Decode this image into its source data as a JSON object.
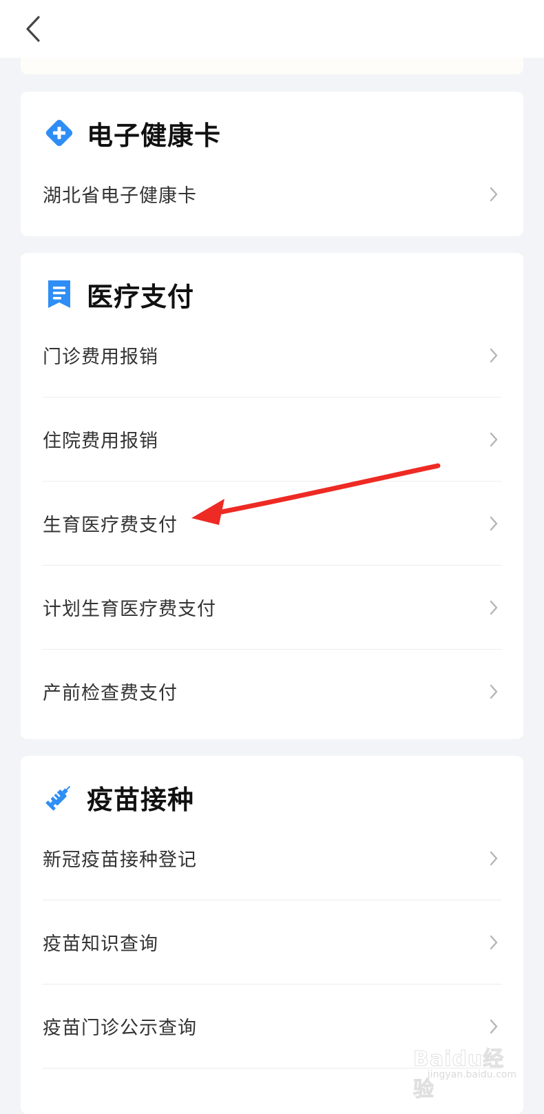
{
  "cards": {
    "health": {
      "title": "电子健康卡",
      "items": [
        "湖北省电子健康卡"
      ]
    },
    "medical": {
      "title": "医疗支付",
      "items": [
        "门诊费用报销",
        "住院费用报销",
        "生育医疗费支付",
        "计划生育医疗费支付",
        "产前检查费支付"
      ]
    },
    "vaccine": {
      "title": "疫苗接种",
      "items": [
        "新冠疫苗接种登记",
        "疫苗知识查询",
        "疫苗门诊公示查询"
      ]
    }
  },
  "watermark": {
    "main": "Baidu经验",
    "sub": "jingyan.baidu.com"
  },
  "colors": {
    "accent": "#2f8ef5",
    "annotation": "#ee2a24",
    "background": "#f3f4f8"
  }
}
